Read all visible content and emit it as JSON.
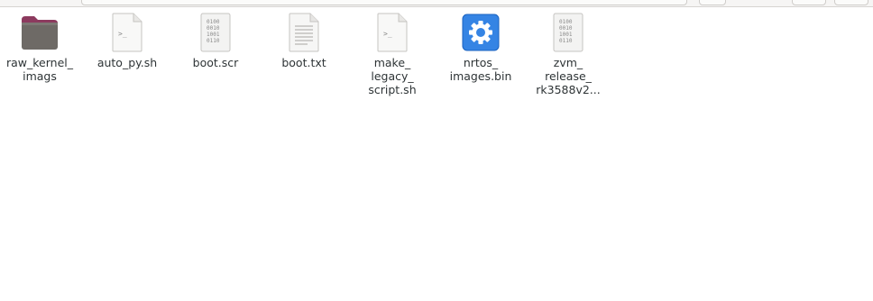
{
  "files": [
    {
      "name": "raw_kernel_\nimags",
      "icon": "folder-icon"
    },
    {
      "name": "auto_py.sh",
      "icon": "script-icon"
    },
    {
      "name": "boot.scr",
      "icon": "binary-file-icon"
    },
    {
      "name": "boot.txt",
      "icon": "text-file-icon"
    },
    {
      "name": "make_\nlegacy_\nscript.sh",
      "icon": "script-icon"
    },
    {
      "name": "nrtos_\nimages.bin",
      "icon": "executable-gear-icon"
    },
    {
      "name": "zvm_\nrelease_\nrk3588v2...",
      "icon": "binary-file-icon"
    }
  ],
  "colors": {
    "folder_body": "#6e6a66",
    "folder_tab": "#8c3a5e",
    "gear_bg": "#3584e4",
    "label_text": "#2e3436"
  }
}
